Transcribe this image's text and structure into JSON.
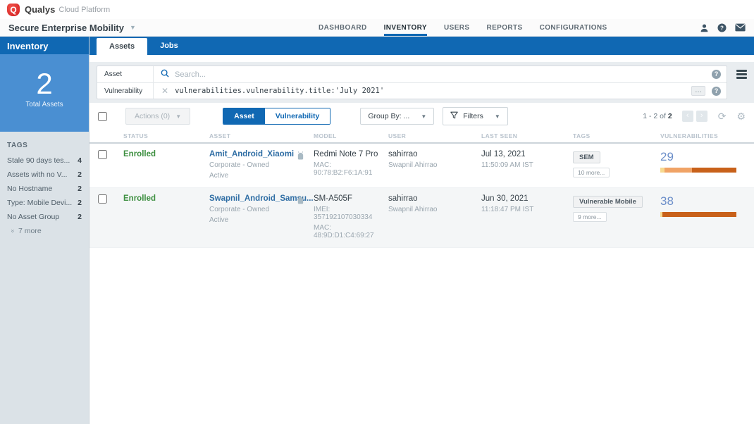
{
  "brand": {
    "name": "Qualys",
    "suffix": "Cloud Platform",
    "logo_letter": "Q"
  },
  "header": {
    "app_title": "Secure Enterprise Mobility",
    "nav": [
      {
        "label": "DASHBOARD"
      },
      {
        "label": "INVENTORY"
      },
      {
        "label": "USERS"
      },
      {
        "label": "REPORTS"
      },
      {
        "label": "CONFIGURATIONS"
      }
    ]
  },
  "sidebar": {
    "title": "Inventory",
    "total_count": "2",
    "total_label": "Total Assets",
    "tags_title": "TAGS",
    "tags": [
      {
        "label": "Stale 90 days tes...",
        "count": "4"
      },
      {
        "label": "Assets with no V...",
        "count": "2"
      },
      {
        "label": "No Hostname",
        "count": "2"
      },
      {
        "label": "Type: Mobile Devi...",
        "count": "2"
      },
      {
        "label": "No Asset Group",
        "count": "2"
      }
    ],
    "more_label": "7 more"
  },
  "main": {
    "tabs": {
      "assets": "Assets",
      "jobs": "Jobs"
    },
    "search": {
      "asset_label": "Asset",
      "asset_placeholder": "Search...",
      "vuln_label": "Vulnerability",
      "vuln_query": "vulnerabilities.vulnerability.title:'July 2021'",
      "expand_button": "…",
      "help_glyph": "?"
    },
    "toolbar": {
      "actions_label": "Actions (0)",
      "asset_toggle": "Asset",
      "vuln_toggle": "Vulnerability",
      "group_by": "Group By: ...",
      "filters": "Filters",
      "pagination_range": "1 - 2 of",
      "pagination_total": "2",
      "prev_glyph": "‹",
      "next_glyph": "›",
      "refresh_glyph": "⟳",
      "gear_glyph": "⚙"
    },
    "table": {
      "columns": {
        "status": "STATUS",
        "asset": "ASSET",
        "model": "MODEL",
        "user": "USER",
        "last_seen": "LAST SEEN",
        "tags": "TAGS",
        "vulns": "VULNERABILITIES"
      },
      "rows": [
        {
          "status": "Enrolled",
          "asset_name": "Amit_Android_Xiaomi",
          "ownership": "Corporate - Owned",
          "state": "Active",
          "model": "Redmi Note 7 Pro",
          "model_line2": "MAC: 90:78:B2:F6:1A:91",
          "model_line3": "",
          "user": "sahirrao",
          "user_full": "Swapnil Ahirrao",
          "last_seen_date": "Jul 13, 2021",
          "last_seen_time": "11:50:09 AM IST",
          "tag": "SEM",
          "tag_more": "10 more...",
          "vuln_count": "29",
          "vuln_bar": [
            {
              "color": "#f7d98f",
              "pct": 6
            },
            {
              "color": "#f0a366",
              "pct": 36
            },
            {
              "color": "#c8611a",
              "pct": 58
            }
          ]
        },
        {
          "status": "Enrolled",
          "asset_name": "Swapnil_Android_Samsu...",
          "ownership": "Corporate - Owned",
          "state": "Active",
          "model": "SM-A505F",
          "model_line2": "IMEI: 357192107030334",
          "model_line3": "MAC: 48:9D:D1:C4:69:27",
          "user": "sahirrao",
          "user_full": "Swapnil Ahirrao",
          "last_seen_date": "Jun 30, 2021",
          "last_seen_time": "11:18:47 PM IST",
          "tag": "Vulnerable Mobile",
          "tag_more": "9 more...",
          "vuln_count": "38",
          "vuln_bar": [
            {
              "color": "#f7d98f",
              "pct": 3
            },
            {
              "color": "#c8611a",
              "pct": 97
            }
          ]
        }
      ]
    }
  },
  "colors": {
    "brand_red": "#d8231f",
    "primary_blue": "#1068b3",
    "panel_blue": "#4a8fd2",
    "status_green": "#3d8f40",
    "link_blue": "#2e6da4",
    "vuln_number_blue": "#6b8ec9",
    "bar_yellow": "#f7d98f",
    "bar_orange": "#f0a366",
    "bar_dark_orange": "#c8611a"
  }
}
